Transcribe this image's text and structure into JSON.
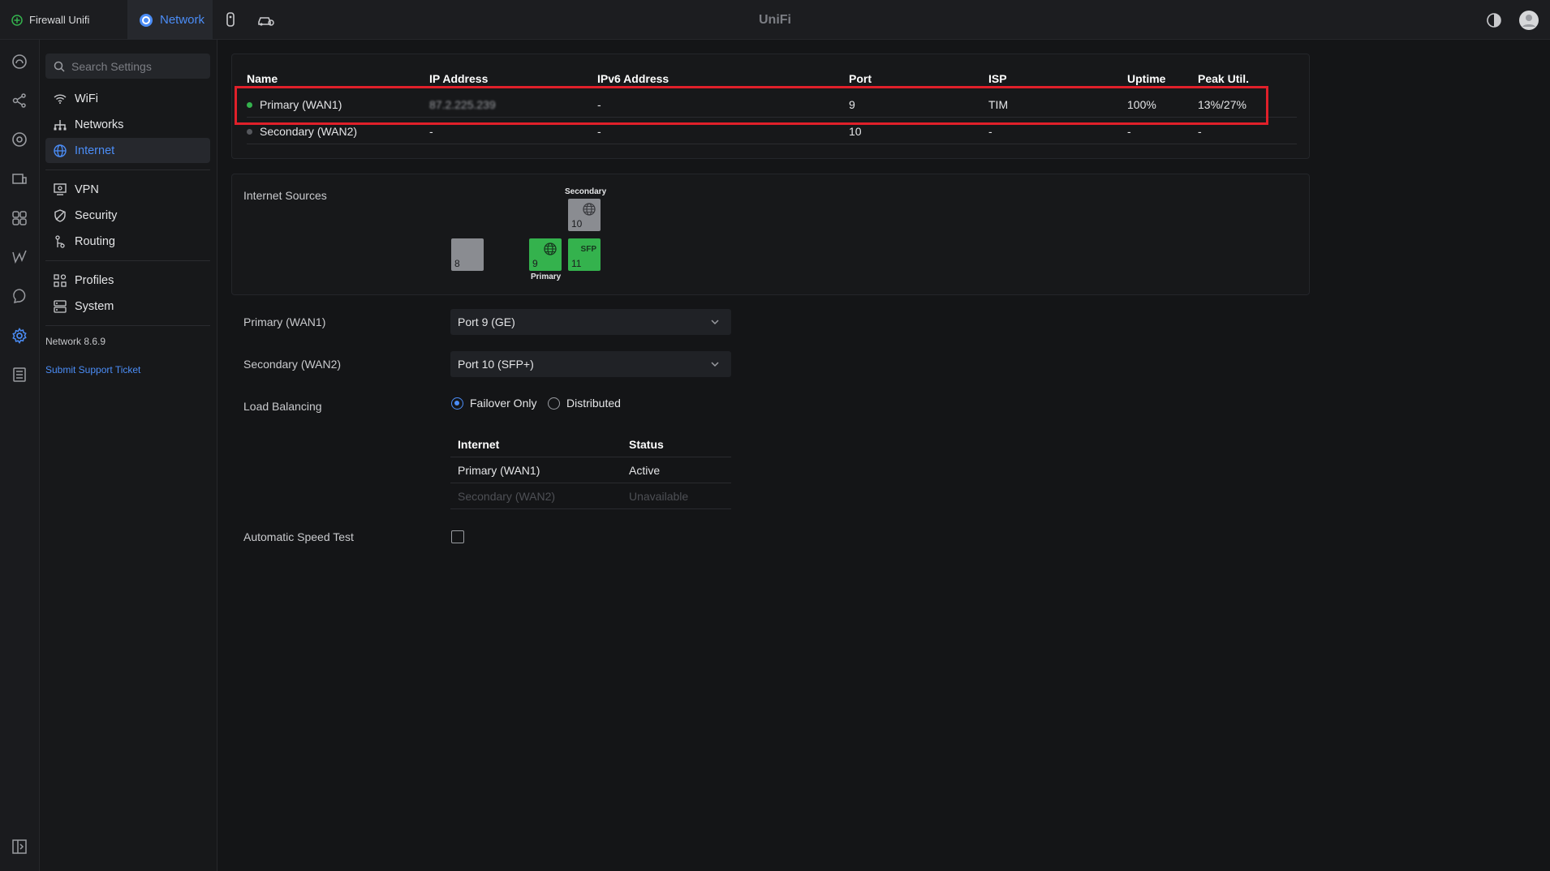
{
  "topbar": {
    "site_name": "Firewall Unifi",
    "network_tab": "Network",
    "app_title": "UniFi"
  },
  "sidebar": {
    "search_placeholder": "Search Settings",
    "items": [
      {
        "label": "WiFi"
      },
      {
        "label": "Networks"
      },
      {
        "label": "Internet"
      },
      {
        "label": "VPN"
      },
      {
        "label": "Security"
      },
      {
        "label": "Routing"
      },
      {
        "label": "Profiles"
      },
      {
        "label": "System"
      }
    ],
    "version": "Network 8.6.9",
    "support_link": "Submit Support Ticket"
  },
  "wan_table": {
    "headers": [
      "Name",
      "IP Address",
      "IPv6 Address",
      "Port",
      "ISP",
      "Uptime",
      "Peak Util."
    ],
    "rows": [
      {
        "name": "Primary (WAN1)",
        "ip": "87.2.225.239",
        "ipv6": "-",
        "port": "9",
        "isp": "TIM",
        "uptime": "100%",
        "peak": "13%/27%",
        "status_color": "#34b24d"
      },
      {
        "name": "Secondary (WAN2)",
        "ip": "-",
        "ipv6": "-",
        "port": "10",
        "isp": "-",
        "uptime": "-",
        "peak": "-",
        "status_color": "#55575c"
      }
    ]
  },
  "internet_sources": {
    "label": "Internet Sources",
    "ports": [
      {
        "num": "8"
      },
      {
        "num": "9"
      },
      {
        "num": "10",
        "caption": "Secondary"
      },
      {
        "num": "11",
        "badge": "SFP"
      }
    ],
    "primary_caption": "Primary"
  },
  "form": {
    "primary_label": "Primary (WAN1)",
    "primary_value": "Port 9 (GE)",
    "secondary_label": "Secondary (WAN2)",
    "secondary_value": "Port 10 (SFP+)",
    "load_balancing_label": "Load Balancing",
    "option_failover": "Failover Only",
    "option_distributed": "Distributed",
    "speed_test_label": "Automatic Speed Test"
  },
  "lb_table": {
    "headers": [
      "Internet",
      "Status"
    ],
    "rows": [
      {
        "internet": "Primary (WAN1)",
        "status": "Active"
      },
      {
        "internet": "Secondary (WAN2)",
        "status": "Unavailable"
      }
    ]
  },
  "colors": {
    "accent": "#4b8df7",
    "active_green": "#34b24d",
    "highlight_red": "#e0202a"
  }
}
